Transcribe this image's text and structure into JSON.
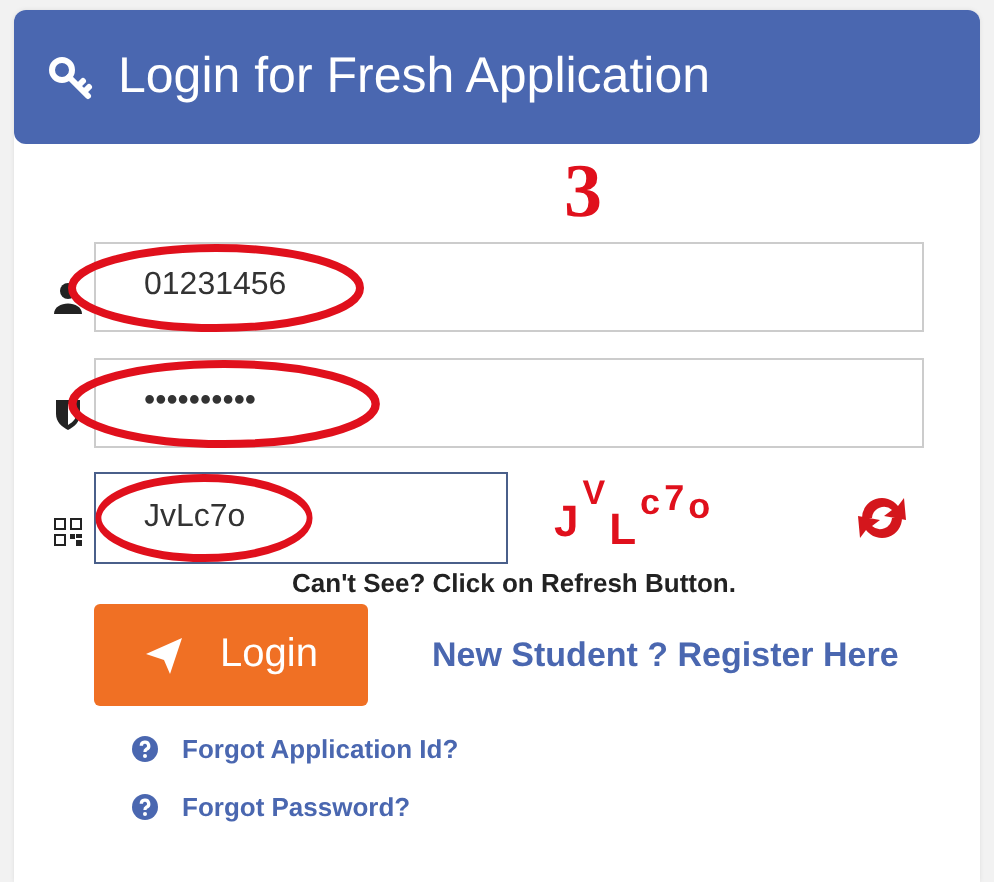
{
  "header": {
    "title": "Login for Fresh Application"
  },
  "annotation": {
    "number": "3"
  },
  "fields": [
    {
      "kind": "user",
      "value": "01231456",
      "highlighted": true
    },
    {
      "kind": "password",
      "value": "••••••••••",
      "highlighted": true
    },
    {
      "kind": "captcha",
      "value": "JvLc7o",
      "highlighted": true,
      "focused": true
    }
  ],
  "captcha": {
    "text": "JVLc7o"
  },
  "hint": "Can't See? Click on Refresh Button.",
  "login_button": "Login",
  "register_link": "New Student ? Register Here",
  "help_links": [
    "Forgot Application Id?",
    "Forgot Password?"
  ]
}
